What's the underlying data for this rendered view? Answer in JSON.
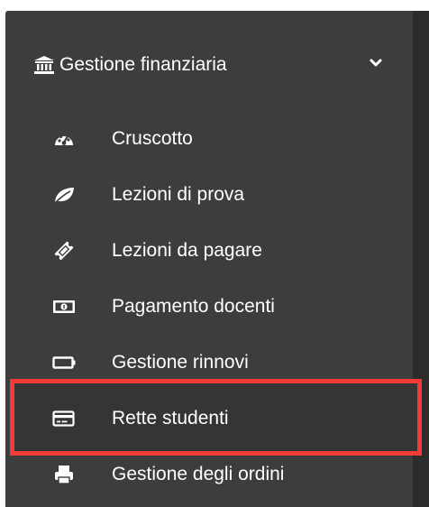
{
  "section": {
    "title": "Gestione finanziaria",
    "icon": "bank-icon",
    "expanded": true
  },
  "menu": {
    "items": [
      {
        "label": "Cruscotto",
        "icon": "dashboard-icon"
      },
      {
        "label": "Lezioni di prova",
        "icon": "leaf-icon"
      },
      {
        "label": "Lezioni da pagare",
        "icon": "ticket-icon"
      },
      {
        "label": "Pagamento docenti",
        "icon": "money-bill-icon"
      },
      {
        "label": "Gestione rinnovi",
        "icon": "battery-empty-icon"
      },
      {
        "label": "Rette studenti",
        "icon": "credit-card-icon",
        "highlighted": true
      },
      {
        "label": "Gestione degli ordini",
        "icon": "printer-icon"
      }
    ]
  },
  "colors": {
    "sidebar_bg": "#3d3d3d",
    "text": "#ffffff",
    "highlight_border": "#f23a37"
  }
}
